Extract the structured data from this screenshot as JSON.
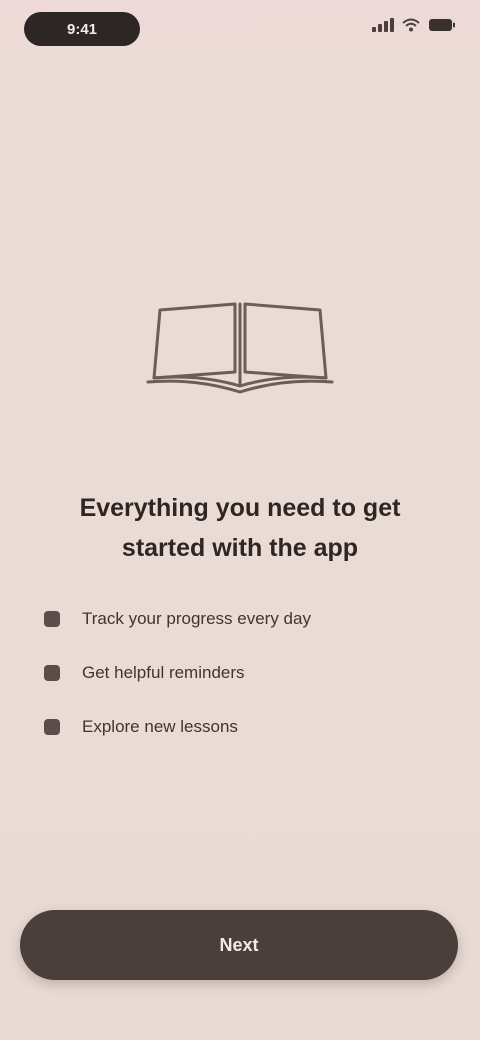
{
  "status_bar": {
    "time": "9:41",
    "icons": [
      "signal-icon",
      "wifi-icon",
      "battery-icon"
    ]
  },
  "illustration": {
    "icon": "open-book-icon"
  },
  "headline": "Everything you need to get started with the app",
  "features": [
    {
      "text": "Track your progress every day"
    },
    {
      "text": "Get helpful reminders"
    },
    {
      "text": "Explore new lessons"
    }
  ],
  "primary_button": {
    "label": "Next"
  },
  "colors": {
    "background": "#e9dbd3",
    "button": "#4b3f3c",
    "text": "#2e2624"
  }
}
